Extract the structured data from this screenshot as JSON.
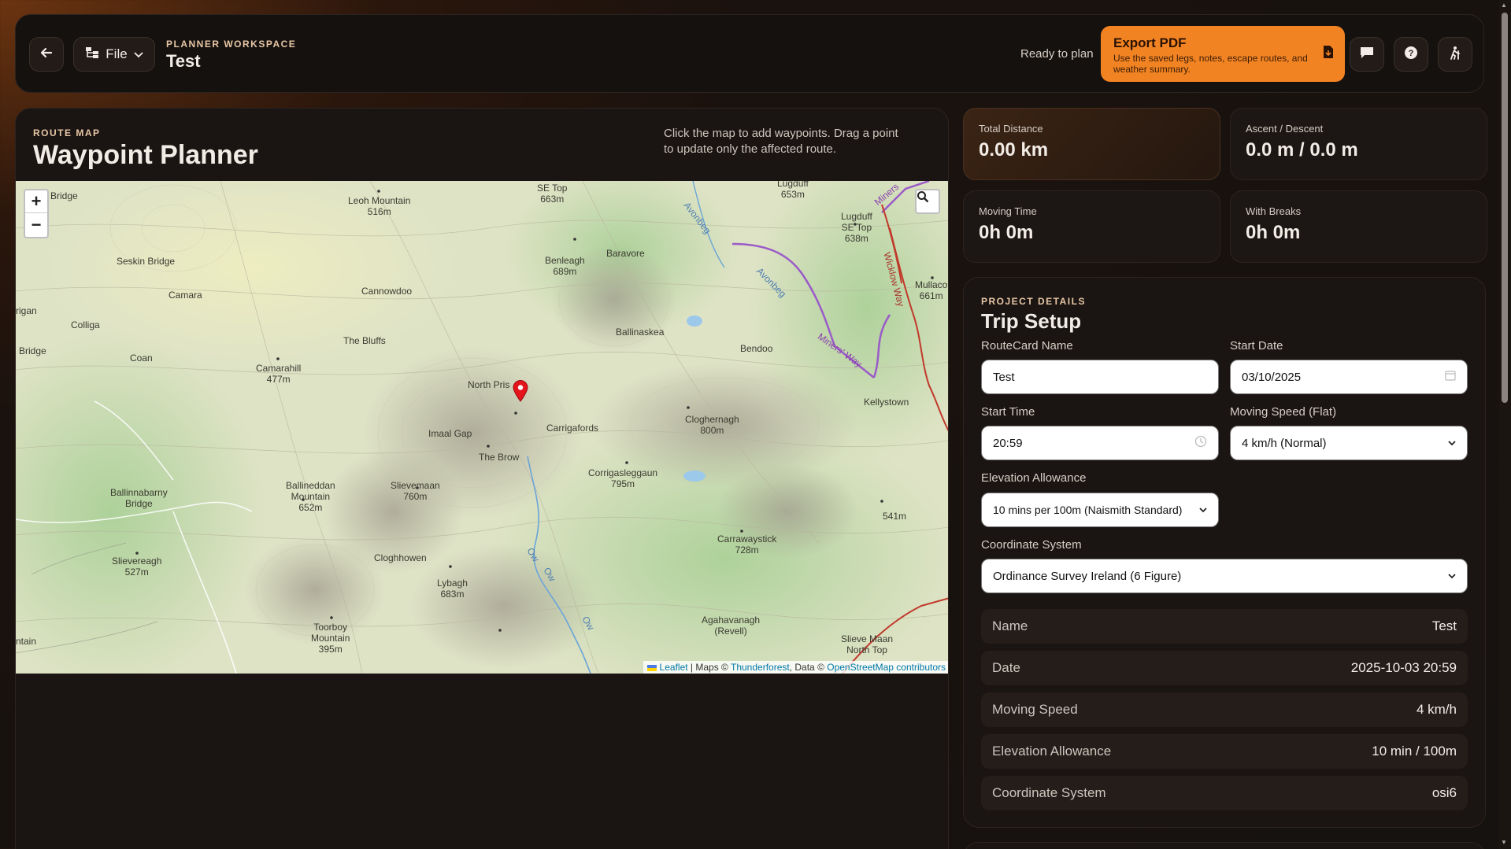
{
  "header": {
    "file_label": "File",
    "workspace_kicker": "PLANNER WORKSPACE",
    "workspace_title": "Test",
    "status": "Ready to plan",
    "export_title": "Export PDF",
    "export_subtitle": "Use the saved legs, notes, escape routes, and weather summary."
  },
  "map": {
    "kicker": "ROUTE MAP",
    "title": "Waypoint Planner",
    "hint": "Click the map to add waypoints. Drag a point to update only the affected route.",
    "zoom_in": "+",
    "zoom_out": "−",
    "attribution": {
      "leaflet": "Leaflet",
      "sep1": " | Maps © ",
      "thunderforest": "Thunderforest",
      "sep2": ", Data © ",
      "osm": "OpenStreetMap contributors"
    },
    "labels": [
      "Bridge",
      "Leoh Mountain\n516m",
      "SE Top\n663m",
      "Lugduff\n653m",
      "Lugduff\nSE Top\n638m",
      "Seskin Bridge",
      "Benleagh\n689m",
      "Baravore",
      "Avonbeg",
      "Camara",
      "Cannowdoo",
      "Colliga",
      "rigan",
      "Mullaco\n661m",
      "Ballinaskea",
      "Avonbeg",
      "The Bluffs",
      "Bridge",
      "Coan",
      "Bendoo",
      "Camarahill\n477m",
      "North Pris",
      "Kellystown",
      "Imaal Gap",
      "Carrigafords",
      "Cloghernagh\n800m",
      "The Brow",
      "Ballineddan\nMountain\n652m",
      "Slievemaan\n760m",
      "Corrigasleggaun\n795m",
      "Ballinnabarny\nBridge",
      "541m",
      "Carrawaystick\n728m",
      "Slievereagh\n527m",
      "Cloghhowen",
      "Lybagh\n683m",
      "Toorboy\nMountain\n395m",
      "Agahavanagh\n(Revell)",
      "Slieve Maan\nNorth Top",
      "ntain",
      "Ow",
      "Ow",
      "Ow",
      "Miners' Way",
      "Wicklow Way",
      "Miners"
    ]
  },
  "stats": {
    "total_distance_label": "Total Distance",
    "total_distance": "0.00 km",
    "ascent_label": "Ascent / Descent",
    "ascent": "0.0 m / 0.0 m",
    "moving_time_label": "Moving Time",
    "moving_time": "0h 0m",
    "with_breaks_label": "With Breaks",
    "with_breaks": "0h 0m"
  },
  "setup": {
    "kicker": "PROJECT DETAILS",
    "title": "Trip Setup",
    "routecard_label": "RouteCard Name",
    "routecard_value": "Test",
    "start_date_label": "Start Date",
    "start_date_value": "03/10/2025",
    "start_time_label": "Start Time",
    "start_time_value": "20:59",
    "speed_label": "Moving Speed (Flat)",
    "speed_value": "4 km/h (Normal)",
    "elevation_label": "Elevation Allowance",
    "elevation_value": "10 mins per 100m (Naismith Standard)",
    "coord_label": "Coordinate System",
    "coord_value": "Ordinance Survey Ireland (6 Figure)",
    "summary": [
      {
        "key": "Name",
        "value": "Test"
      },
      {
        "key": "Date",
        "value": "2025-10-03 20:59"
      },
      {
        "key": "Moving Speed",
        "value": "4 km/h"
      },
      {
        "key": "Elevation Allowance",
        "value": "10 min / 100m"
      },
      {
        "key": "Coordinate System",
        "value": "osi6"
      }
    ]
  },
  "colors": {
    "accent": "#f28322",
    "panel": "#1a1412",
    "map_base": "#dfe6c4",
    "forest": "#b9d8a0",
    "route_purple": "#9a5bc8",
    "route_red": "#c0392b",
    "marker": "#e3141b"
  }
}
